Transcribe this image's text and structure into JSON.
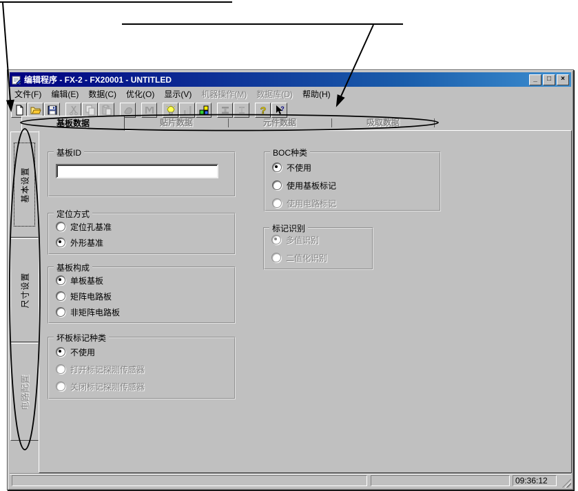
{
  "colors": {
    "chrome": "#c0c0c0",
    "titlebar_gradient_start": "#000080",
    "titlebar_gradient_end": "#3d8fd1",
    "disabled_text": "#848484",
    "annotation_line": "#000000",
    "input_background": "#ffffff"
  },
  "window": {
    "title": "编辑程序 - FX-2 - FX20001 - UNTITLED",
    "minimize_label": "_",
    "maximize_label": "□",
    "close_label": "×"
  },
  "menu": {
    "items": [
      {
        "label": "文件(F)",
        "enabled": true
      },
      {
        "label": "编辑(E)",
        "enabled": true
      },
      {
        "label": "数据(C)",
        "enabled": true
      },
      {
        "label": "优化(O)",
        "enabled": true
      },
      {
        "label": "显示(V)",
        "enabled": true
      },
      {
        "label": "机器操作(M)",
        "enabled": false
      },
      {
        "label": "数据库(D)",
        "enabled": false
      },
      {
        "label": "帮助(H)",
        "enabled": true
      }
    ]
  },
  "toolbar": {
    "buttons": [
      {
        "icon": "new-document-icon",
        "enabled": true
      },
      {
        "icon": "open-folder-icon",
        "enabled": true
      },
      {
        "icon": "save-icon",
        "enabled": true
      },
      {
        "icon": "cut-icon",
        "enabled": false
      },
      {
        "icon": "copy-icon",
        "enabled": false
      },
      {
        "icon": "paste-icon",
        "enabled": false
      },
      {
        "icon": "download-icon",
        "enabled": false
      },
      {
        "icon": "binoculars-icon",
        "enabled": false
      },
      {
        "icon": "lightbulb-icon",
        "enabled": true
      },
      {
        "icon": "statistics-icon",
        "enabled": false
      },
      {
        "icon": "blocks-icon",
        "enabled": true
      },
      {
        "icon": "beam-tool-icon",
        "enabled": false
      },
      {
        "icon": "ibeam-tool-icon",
        "enabled": false
      },
      {
        "icon": "help-icon",
        "enabled": true
      },
      {
        "icon": "context-help-icon",
        "enabled": true
      }
    ]
  },
  "top_tabs": [
    {
      "label": "基板数据",
      "active": true,
      "enabled": true
    },
    {
      "label": "贴片数据",
      "active": false,
      "enabled": false
    },
    {
      "label": "元件数据",
      "active": false,
      "enabled": false
    },
    {
      "label": "吸取数据",
      "active": false,
      "enabled": false
    }
  ],
  "side_tabs": [
    {
      "label": "基本设置",
      "active": true,
      "enabled": true
    },
    {
      "label": "尺寸设置",
      "active": false,
      "enabled": true
    },
    {
      "label": "电路配置",
      "active": false,
      "enabled": false
    }
  ],
  "form": {
    "board_id": {
      "label": "基板ID",
      "value": ""
    },
    "positioning": {
      "label": "定位方式",
      "options": [
        {
          "label": "定位孔基准",
          "selected": false,
          "enabled": true
        },
        {
          "label": "外形基准",
          "selected": true,
          "enabled": true
        }
      ]
    },
    "board_structure": {
      "label": "基板构成",
      "options": [
        {
          "label": "单板基板",
          "selected": true,
          "enabled": true
        },
        {
          "label": "矩阵电路板",
          "selected": false,
          "enabled": true
        },
        {
          "label": "非矩阵电路板",
          "selected": false,
          "enabled": true
        }
      ]
    },
    "bad_mark": {
      "label": "坏板标记种类",
      "options": [
        {
          "label": "不使用",
          "selected": true,
          "enabled": true
        },
        {
          "label": "打开标记探测传感器",
          "selected": false,
          "enabled": false
        },
        {
          "label": "关闭标记探测传感器",
          "selected": false,
          "enabled": false
        }
      ]
    },
    "boc_type": {
      "label": "BOC种类",
      "options": [
        {
          "label": "不使用",
          "selected": true,
          "enabled": true
        },
        {
          "label": "使用基板标记",
          "selected": false,
          "enabled": true
        },
        {
          "label": "使用电路标记",
          "selected": false,
          "enabled": false
        }
      ]
    },
    "mark_recognition": {
      "label": "标记识别",
      "options": [
        {
          "label": "多值识别",
          "selected": true,
          "enabled": false
        },
        {
          "label": "二值化识别",
          "selected": false,
          "enabled": false
        }
      ]
    }
  },
  "statusbar": {
    "time": "09:36:12"
  }
}
